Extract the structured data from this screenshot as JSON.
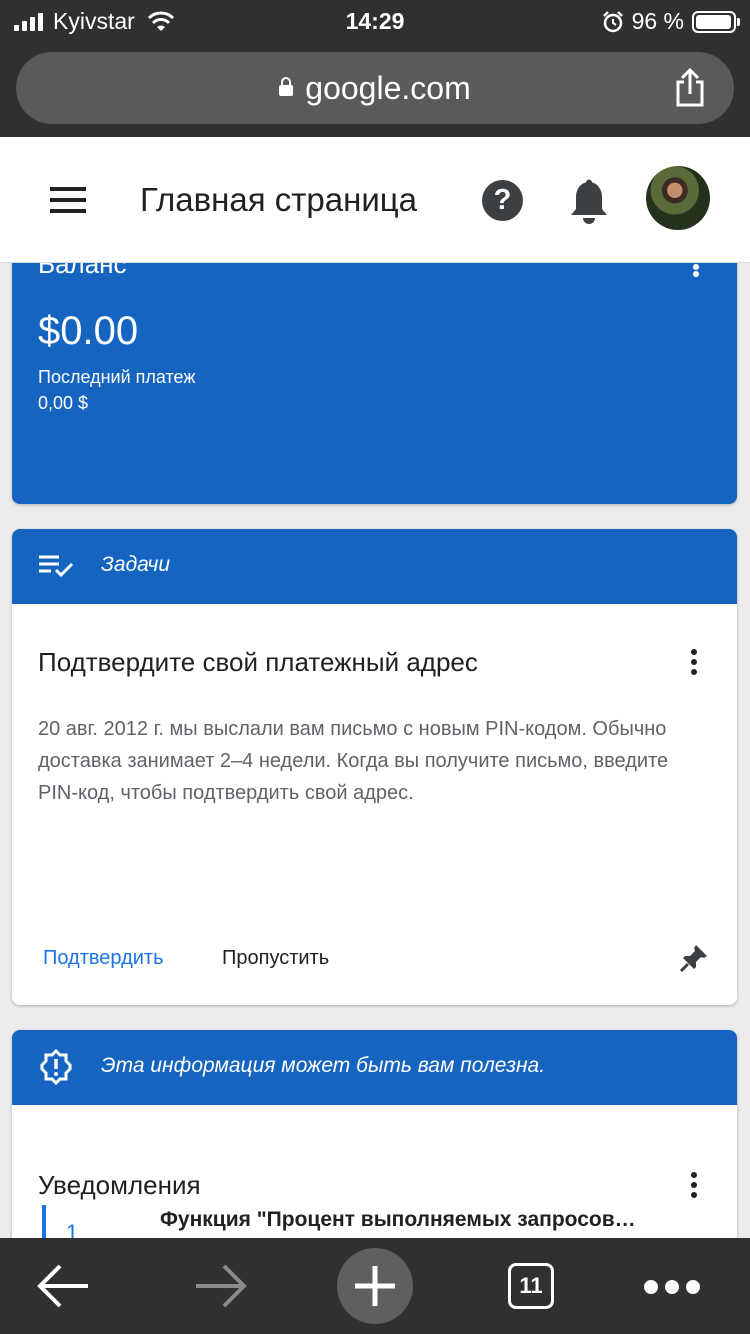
{
  "status_bar": {
    "carrier": "Kyivstar",
    "time": "14:29",
    "battery": "96 %",
    "battery_level": 0.96
  },
  "browser": {
    "url": "google.com",
    "tab_count": "11"
  },
  "header": {
    "title": "Главная страница",
    "help": "?"
  },
  "balance_card": {
    "title": "Баланс",
    "amount": "$0.00",
    "last_payment_label": "Последний платеж",
    "last_payment_value": "0,00 $"
  },
  "tasks_card": {
    "header": "Задачи",
    "title": "Подтвердите свой платежный адрес",
    "body": "20 авг. 2012 г. мы выслали вам письмо с новым PIN-кодом. Обычно доставка занимает 2–4 недели. Когда вы получите письмо, введите PIN-код, чтобы подтвердить свой адрес.",
    "confirm_label": "Подтвердить",
    "skip_label": "Пропустить"
  },
  "info_card": {
    "header": "Эта информация может быть вам полезна.",
    "title": "Уведомления",
    "items": [
      {
        "number": "1",
        "text": "Функция \"Процент выполняемых запросов…"
      }
    ]
  },
  "colors": {
    "accent": "#1565c0",
    "link": "#1a73e8",
    "browser_chrome": "#303030"
  }
}
